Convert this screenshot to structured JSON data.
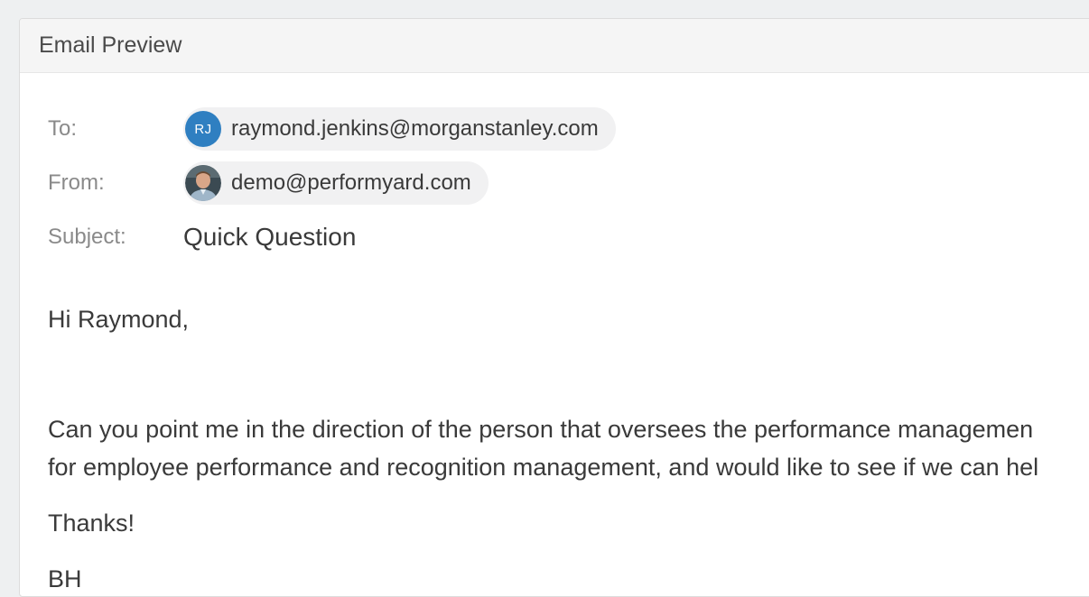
{
  "panel": {
    "title": "Email Preview"
  },
  "email": {
    "to_label": "To:",
    "to_initials": "RJ",
    "to_address": "raymond.jenkins@morganstanley.com",
    "from_label": "From:",
    "from_address": "demo@performyard.com",
    "subject_label": "Subject:",
    "subject": "Quick Question",
    "greeting": "Hi Raymond,",
    "body_line_1": "Can you point me in the direction of the person that oversees the performance managemen",
    "body_line_2": "for employee performance and recognition management, and would like to see if we can hel",
    "thanks": "Thanks!",
    "signature": "BH"
  },
  "colors": {
    "to_avatar_bg": "#2f7fc1",
    "chip_bg": "#f1f1f2"
  },
  "icons": {
    "from_avatar": "person-photo-avatar"
  }
}
